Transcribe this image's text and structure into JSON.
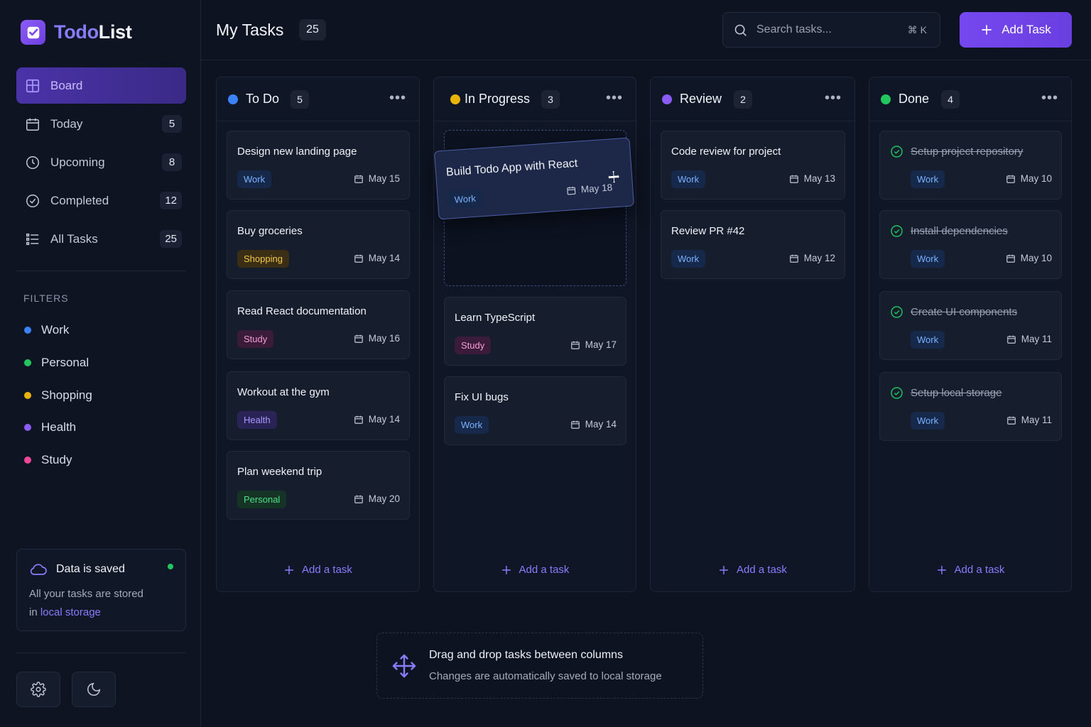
{
  "app": {
    "name_part1": "Todo",
    "name_part2": "List"
  },
  "sidebar": {
    "nav": [
      {
        "label": "Board",
        "count": ""
      },
      {
        "label": "Today",
        "count": "5"
      },
      {
        "label": "Upcoming",
        "count": "8"
      },
      {
        "label": "Completed",
        "count": "12"
      },
      {
        "label": "All Tasks",
        "count": "25"
      }
    ],
    "filters_title": "FILTERS",
    "filters": [
      {
        "label": "Work",
        "color": "#3b82f6"
      },
      {
        "label": "Personal",
        "color": "#22c55e"
      },
      {
        "label": "Shopping",
        "color": "#eab308"
      },
      {
        "label": "Health",
        "color": "#8b5cf6"
      },
      {
        "label": "Study",
        "color": "#ec4899"
      }
    ],
    "saved": {
      "title": "Data is saved",
      "body_prefix": "All your tasks are stored",
      "body_in": "in ",
      "body_link": "local storage"
    }
  },
  "header": {
    "title": "My Tasks",
    "count": "25",
    "search_placeholder": "Search tasks...",
    "shortcut": "⌘ K",
    "add_button": "Add Task"
  },
  "columns": [
    {
      "title": "To Do",
      "count": "5",
      "color": "#3b82f6",
      "cards": [
        {
          "title": "Design new landing page",
          "tag": "Work",
          "date": "May 15"
        },
        {
          "title": "Buy groceries",
          "tag": "Shopping",
          "date": "May 14"
        },
        {
          "title": "Read React documentation",
          "tag": "Study",
          "date": "May 16"
        },
        {
          "title": "Workout at the gym",
          "tag": "Health",
          "date": "May 14"
        },
        {
          "title": "Plan weekend trip",
          "tag": "Personal",
          "date": "May 20"
        }
      ]
    },
    {
      "title": "In Progress",
      "count": "3",
      "color": "#eab308",
      "dragging": {
        "title": "Build Todo App with React",
        "tag": "Work",
        "date": "May 18"
      },
      "cards": [
        {
          "title": "Learn TypeScript",
          "tag": "Study",
          "date": "May 17"
        },
        {
          "title": "Fix UI bugs",
          "tag": "Work",
          "date": "May 14"
        }
      ]
    },
    {
      "title": "Review",
      "count": "2",
      "color": "#8b5cf6",
      "cards": [
        {
          "title": "Code review for project",
          "tag": "Work",
          "date": "May 13"
        },
        {
          "title": "Review PR #42",
          "tag": "Work",
          "date": "May 12"
        }
      ]
    },
    {
      "title": "Done",
      "count": "4",
      "color": "#22c55e",
      "cards": [
        {
          "title": "Setup project repository",
          "tag": "Work",
          "date": "May 10"
        },
        {
          "title": "Install dependencies",
          "tag": "Work",
          "date": "May 10"
        },
        {
          "title": "Create UI components",
          "tag": "Work",
          "date": "May 11"
        },
        {
          "title": "Setup local storage",
          "tag": "Work",
          "date": "May 11"
        }
      ]
    }
  ],
  "add_task_label": "Add a task",
  "hint": {
    "title": "Drag and drop tasks between columns",
    "subtitle": "Changes are automatically saved to local storage"
  }
}
